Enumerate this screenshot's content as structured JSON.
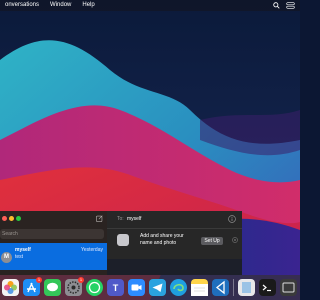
{
  "menubar": {
    "item_conversations": "onversations",
    "item_window": "Window",
    "item_help": "Help",
    "spotlight_icon": "search-icon",
    "control_icon": "control-center-icon"
  },
  "colors": {
    "accent_blue": "#0a6de0",
    "badge_red": "#ff3b30"
  },
  "messages": {
    "search_placeholder": "Search",
    "conversation": {
      "initial": "M",
      "name": "myself",
      "time": "Yesterday",
      "preview": "test"
    },
    "chat": {
      "to_label": "To:",
      "to_value": "myself",
      "banner_line1": "Add and share your",
      "banner_line2": "name and photo",
      "setup_button": "Set Up"
    }
  },
  "dock": {
    "apps": [
      {
        "name": "Photos",
        "icon": "photos-icon"
      },
      {
        "name": "App Store",
        "icon": "app-store-icon",
        "badge": "1"
      },
      {
        "name": "Messages",
        "icon": "messages-icon"
      },
      {
        "name": "System Preferences",
        "icon": "settings-icon",
        "badge": "1"
      },
      {
        "name": "WhatsApp",
        "icon": "whatsapp-icon"
      },
      {
        "name": "Teams",
        "icon": "teams-icon"
      },
      {
        "name": "Zoom",
        "icon": "zoom-icon"
      },
      {
        "name": "Telegram",
        "icon": "telegram-icon"
      },
      {
        "name": "Edge",
        "icon": "edge-icon"
      },
      {
        "name": "Notes",
        "icon": "notes-icon"
      },
      {
        "name": "VS Code",
        "icon": "vscode-icon"
      },
      {
        "name": "Preview",
        "icon": "preview-icon"
      },
      {
        "name": "Terminal",
        "icon": "terminal-icon"
      },
      {
        "name": "Unknown",
        "icon": "app-icon"
      }
    ]
  }
}
